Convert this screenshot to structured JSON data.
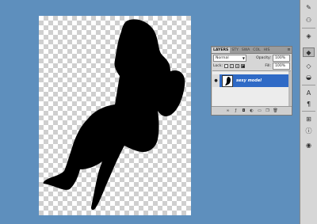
{
  "layers_panel": {
    "tabs": [
      "LAYERS",
      "STY",
      "SWA",
      "COL",
      "HIS"
    ],
    "blend_mode": "Normal",
    "opacity_label": "Opacity:",
    "opacity_value": "100%",
    "lock_label": "Lock:",
    "fill_label": "Fill:",
    "fill_value": "100%",
    "layer_name": "sexy model"
  },
  "dock_icons": [
    "brush-icon",
    "clone-icon",
    "layers-icon",
    "channels-icon",
    "paths-icon",
    "adjust-icon",
    "text-icon",
    "paragraph-icon",
    "history-icon",
    "info-icon",
    "color-icon"
  ]
}
